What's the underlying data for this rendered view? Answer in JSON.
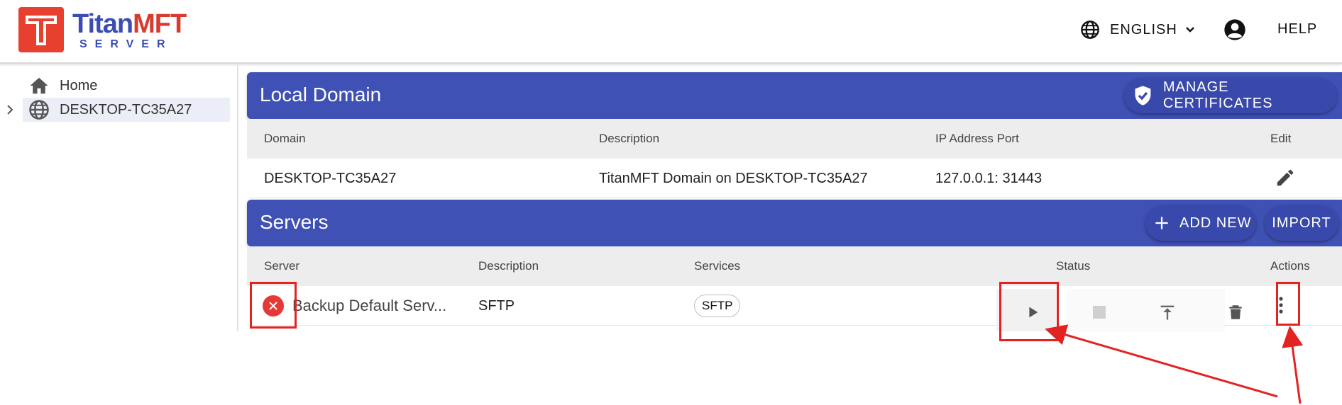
{
  "app": {
    "logo_title_a": "Titan",
    "logo_title_b": "MFT",
    "logo_sub": "SERVER"
  },
  "header": {
    "language": "ENGLISH",
    "help": "HELP"
  },
  "sidebar": {
    "items": [
      {
        "label": "Home"
      },
      {
        "label": "DESKTOP-TC35A27"
      }
    ]
  },
  "local_domain": {
    "title": "Local Domain",
    "manage_certs": "MANAGE CERTIFICATES",
    "columns": [
      "Domain",
      "Description",
      "IP Address Port",
      "Edit"
    ],
    "rows": [
      {
        "domain": "DESKTOP-TC35A27",
        "description": "TitanMFT Domain on DESKTOP-TC35A27",
        "ip_port": "127.0.0.1: 31443"
      }
    ]
  },
  "servers": {
    "title": "Servers",
    "add_new": "ADD NEW",
    "import": "IMPORT",
    "columns": [
      "Server",
      "Description",
      "Services",
      "Status",
      "Actions"
    ],
    "rows": [
      {
        "server": "Backup Default Serv...",
        "description": "SFTP",
        "service_chip": "SFTP",
        "status": "stopped"
      }
    ]
  },
  "colors": {
    "brand_red": "#d93a2e",
    "brand_blue": "#3f51b5",
    "annotation_red": "#e32222"
  }
}
